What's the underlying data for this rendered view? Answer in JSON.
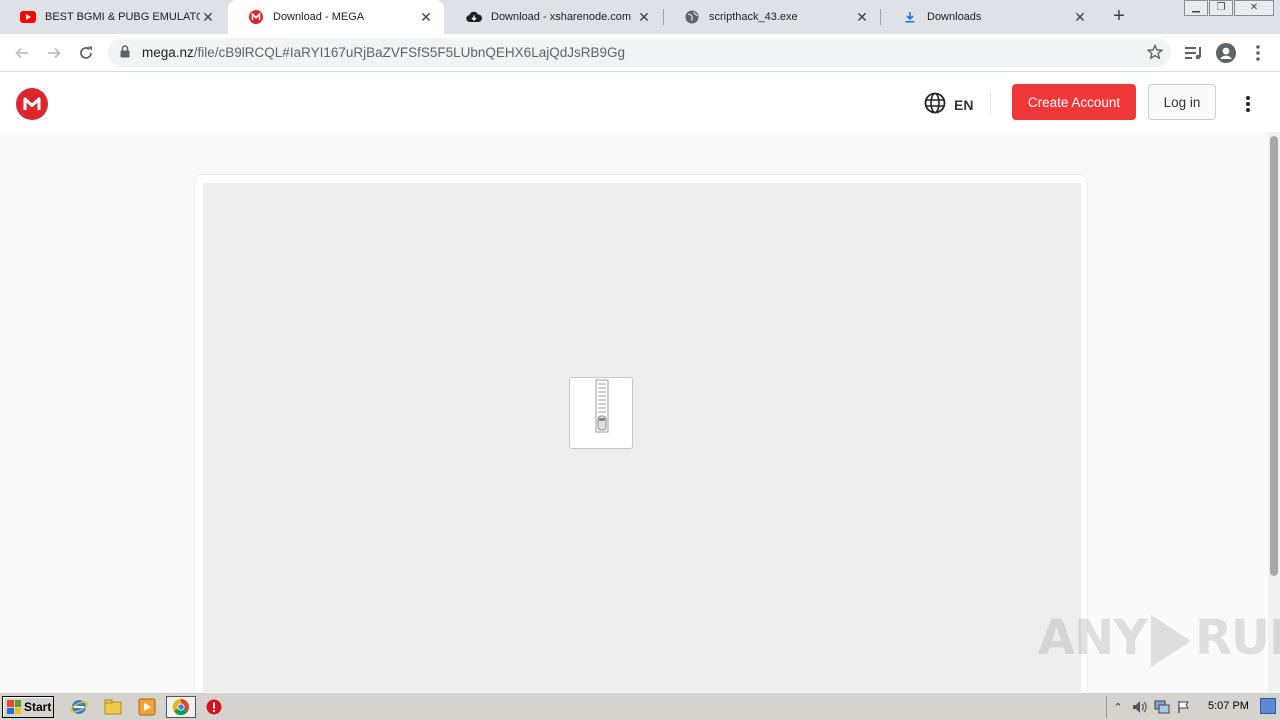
{
  "browser": {
    "tabs": [
      {
        "title": "BEST BGMI & PUBG EMULATOR |",
        "icon": "youtube-icon",
        "active": false
      },
      {
        "title": "Download - MEGA",
        "icon": "mega-icon",
        "active": true
      },
      {
        "title": "Download - xsharenode.com",
        "icon": "cloud-download-icon",
        "active": false
      },
      {
        "title": "scripthack_43.exe",
        "icon": "globe-icon",
        "active": false
      },
      {
        "title": "Downloads",
        "icon": "download-icon",
        "active": false
      }
    ],
    "url_host": "mega.nz",
    "url_path": "/file/cB9lRCQL#IaRYI167uRjBaZVFSfS5F5LUbnQEHX6LajQdJsRB9Gg"
  },
  "mega_header": {
    "language": "EN",
    "create_account_label": "Create Account",
    "login_label": "Log in"
  },
  "preview": {
    "file_type_icon": "zip-archive-icon"
  },
  "watermark": {
    "left": "ANY",
    "right": "RUN"
  },
  "taskbar": {
    "start_label": "Start",
    "apps": [
      "ie-icon",
      "explorer-icon",
      "media-player-icon",
      "chrome-icon",
      "stop-icon"
    ],
    "clock": "5:07 PM"
  },
  "colors": {
    "mega_red": "#d9272e",
    "create_button": "#f0373a",
    "preview_bg": "#eeeeee",
    "tabstrip_bg": "#dee1e6"
  }
}
